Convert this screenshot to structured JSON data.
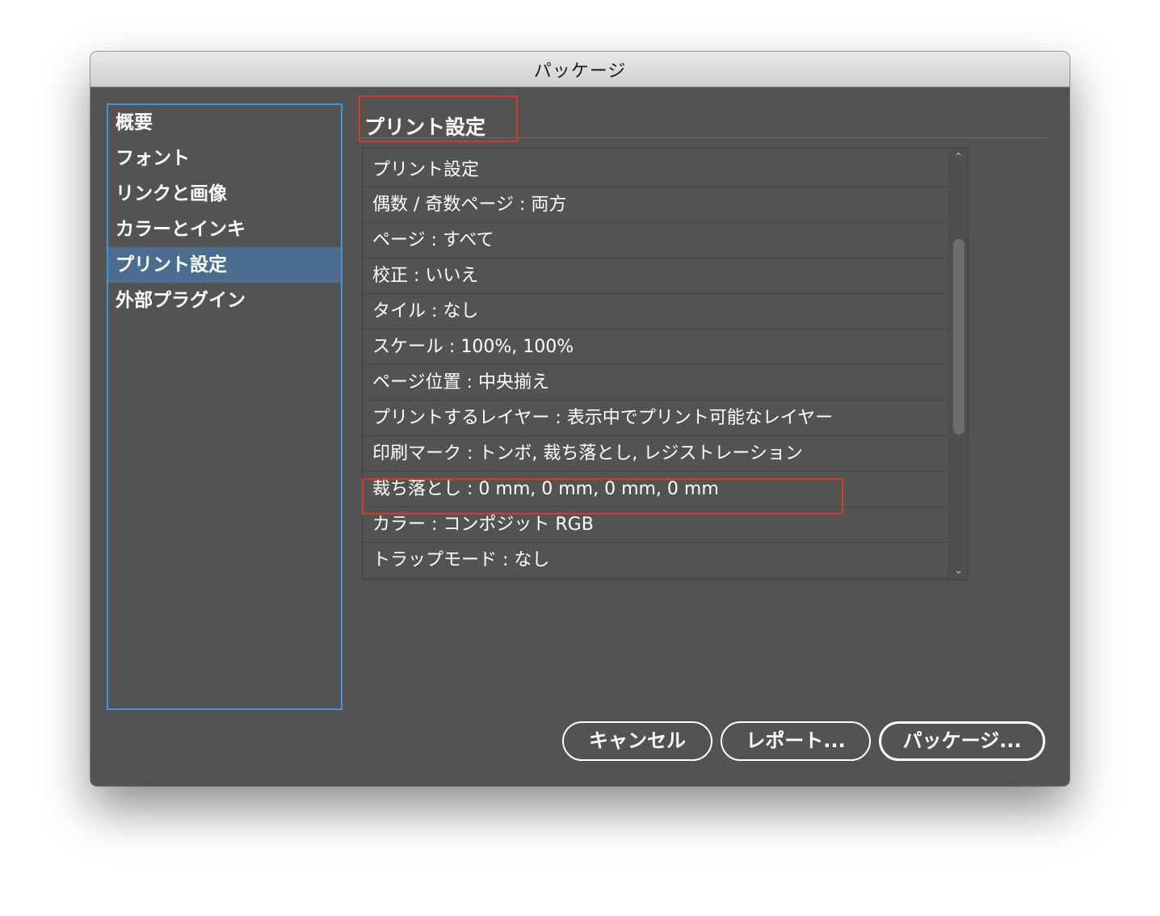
{
  "window": {
    "title": "パッケージ"
  },
  "sidebar": {
    "items": [
      {
        "label": "概要",
        "active": false
      },
      {
        "label": "フォント",
        "active": false
      },
      {
        "label": "リンクと画像",
        "active": false
      },
      {
        "label": "カラーとインキ",
        "active": false
      },
      {
        "label": "プリント設定",
        "active": true
      },
      {
        "label": "外部プラグイン",
        "active": false
      }
    ]
  },
  "main": {
    "title": "プリント設定",
    "list": [
      "プリント設定",
      "偶数 / 奇数ページ : 両方",
      "ページ : すべて",
      "校正 : いいえ",
      "タイル : なし",
      "スケール : 100%, 100%",
      "ページ位置 : 中央揃え",
      "プリントするレイヤー : 表示中でプリント可能なレイヤー",
      "印刷マーク : トンボ, 裁ち落とし, レジストレーション",
      "裁ち落とし : 0 mm, 0 mm, 0 mm, 0 mm",
      "カラー : コンポジット RGB",
      "トラップモード : なし"
    ]
  },
  "buttons": {
    "cancel": "キャンセル",
    "report": "レポート...",
    "package": "パッケージ..."
  },
  "colors": {
    "panel": "#535353",
    "selection": "#4b6d8f",
    "focus_ring": "#4a90d9",
    "highlight_box": "#d23a2a"
  }
}
